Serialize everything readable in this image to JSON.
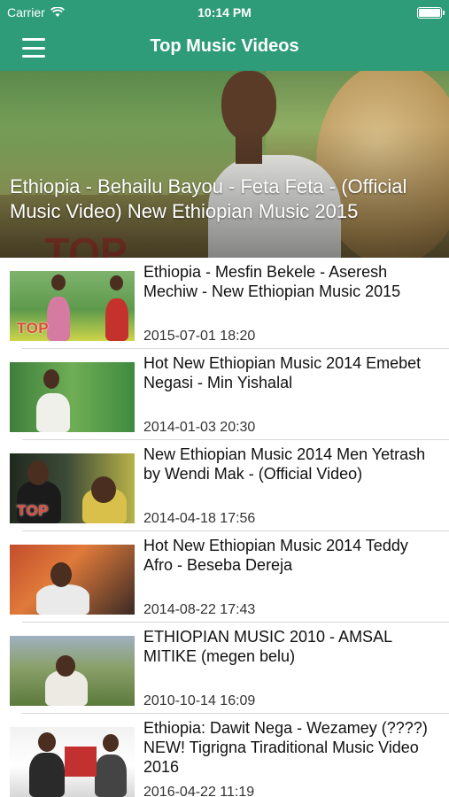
{
  "status_bar": {
    "carrier": "Carrier",
    "time": "10:14 PM",
    "wifi_icon": "wifi-icon",
    "battery_icon": "battery-icon"
  },
  "nav": {
    "title": "Top Music Videos",
    "menu_icon": "hamburger-menu-icon"
  },
  "featured": {
    "title": "Ethiopia - Behailu Bayou - Feta Feta - (Official Music Video) New Ethiopian Music 2015"
  },
  "videos": [
    {
      "title": "Ethiopia - Mesfin Bekele - Aseresh Mechiw - New Ethiopian Music 2015",
      "date": "2015-07-01 18:20",
      "badge": "TOP"
    },
    {
      "title": "Hot New Ethiopian Music 2014 Emebet Negasi - Min Yishalal",
      "date": "2014-01-03 20:30",
      "badge": ""
    },
    {
      "title": "New Ethiopian Music 2014 Men Yetrash by Wendi Mak - (Official Video)",
      "date": "2014-04-18 17:56",
      "badge": "TOP"
    },
    {
      "title": "Hot New Ethiopian Music 2014 Teddy Afro - Beseba Dereja",
      "date": "2014-08-22 17:43",
      "badge": ""
    },
    {
      "title": "ETHIOPIAN MUSIC 2010 - AMSAL MITIKE (megen belu)",
      "date": "2010-10-14 16:09",
      "badge": ""
    },
    {
      "title": "Ethiopia: Dawit Nega - Wezamey (????) NEW! Tigrigna Tiraditional Music Video 2016",
      "date": "2016-04-22 11:19",
      "badge": ""
    }
  ]
}
